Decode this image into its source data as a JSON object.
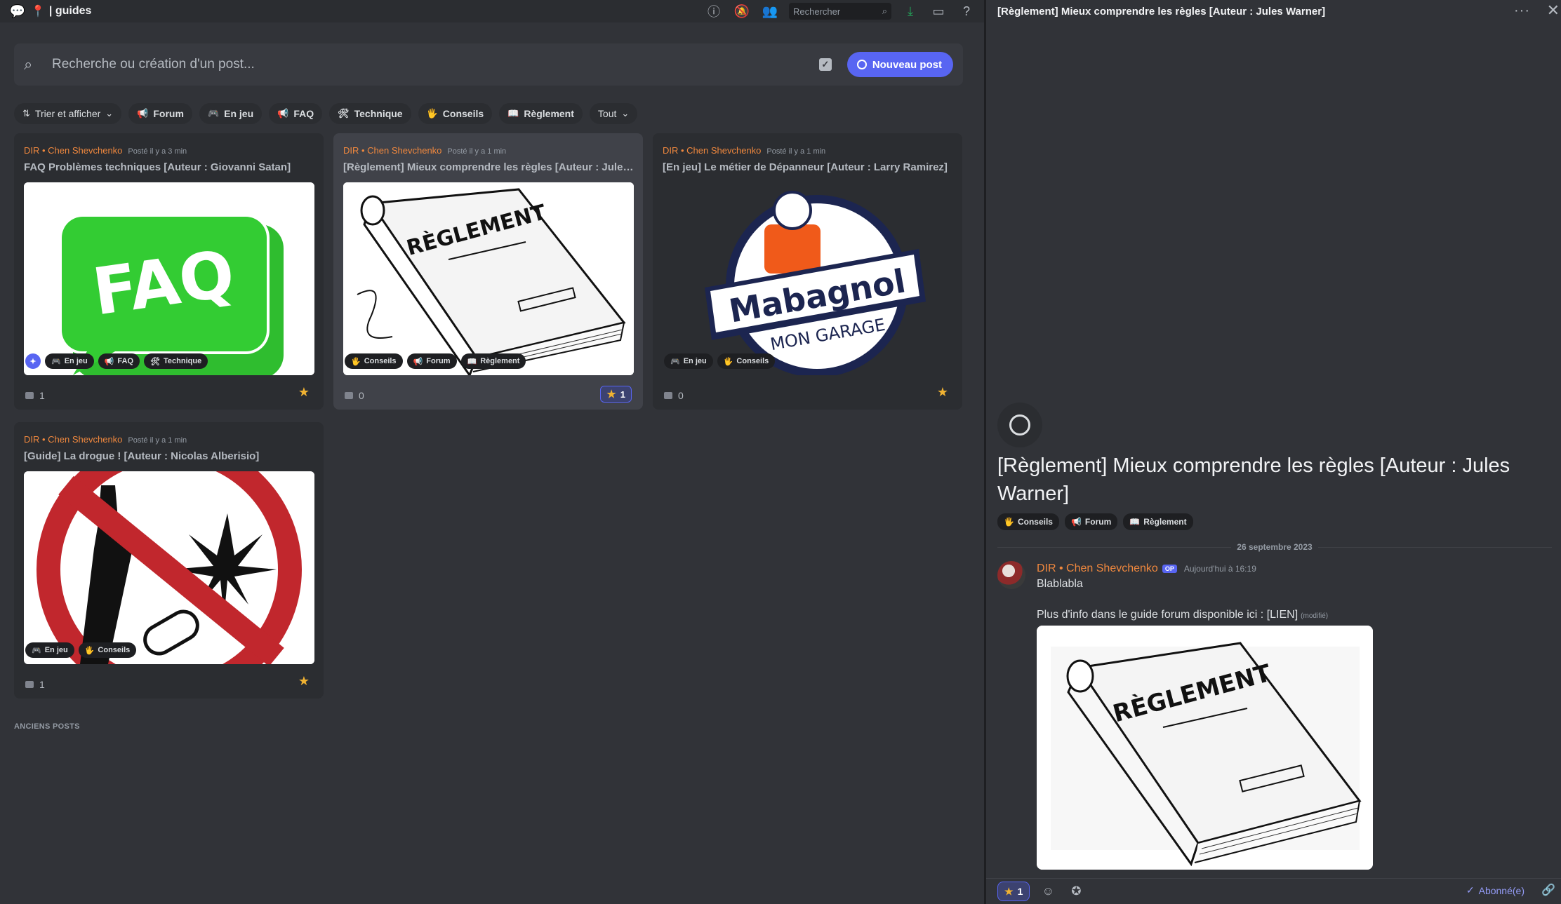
{
  "channel": {
    "emoji": "📍",
    "name": "| guides"
  },
  "topbar": {
    "search_placeholder": "Rechercher"
  },
  "searchbar": {
    "placeholder": "Recherche ou création d'un post...",
    "new_post_label": "Nouveau post"
  },
  "filters": {
    "sort_label": "Trier et afficher",
    "tags": [
      {
        "emoji": "📢",
        "label": "Forum"
      },
      {
        "emoji": "🎮",
        "label": "En jeu"
      },
      {
        "emoji": "📢",
        "label": "FAQ"
      },
      {
        "emoji": "🛠",
        "label": "Technique"
      },
      {
        "emoji": "🖐",
        "label": "Conseils"
      },
      {
        "emoji": "📖",
        "label": "Règlement"
      }
    ],
    "all_label": "Tout"
  },
  "posts": [
    {
      "author": "DIR • Chen Shevchenko",
      "time": "Posté il y a 3 min",
      "title": "FAQ Problèmes techniques [Auteur : Giovanni Satan]",
      "image": "FAQ",
      "tags": [
        "En jeu",
        "FAQ",
        "Technique"
      ],
      "comments": "1"
    },
    {
      "author": "DIR • Chen Shevchenko",
      "time": "Posté il y a 1 min",
      "title": "[Règlement] Mieux comprendre les règles [Auteur : Jules Warner]",
      "image": "RÈGLEMENT",
      "tags": [
        "Conseils",
        "Forum",
        "Règlement"
      ],
      "comments": "0",
      "stars": "1"
    },
    {
      "author": "DIR • Chen Shevchenko",
      "time": "Posté il y a 1 min",
      "title": "[En jeu] Le métier de Dépanneur [Auteur : Larry Ramirez]",
      "image_text_1": "Mabagnol",
      "image_text_2": "MON GARAGE",
      "tags": [
        "En jeu",
        "Conseils"
      ],
      "comments": "0"
    },
    {
      "author": "DIR • Chen Shevchenko",
      "time": "Posté il y a 1 min",
      "title": "[Guide] La drogue ! [Auteur : Nicolas Alberisio]",
      "tags": [
        "En jeu",
        "Conseils"
      ],
      "comments": "1"
    }
  ],
  "older_posts_label": "ANCIENS POSTS",
  "thread": {
    "header_title": "[Règlement] Mieux comprendre les règles [Auteur : Jules Warner]",
    "title": "[Règlement] Mieux comprendre les règles [Auteur : Jules Warner]",
    "tags": [
      {
        "emoji": "🖐",
        "label": "Conseils"
      },
      {
        "emoji": "📢",
        "label": "Forum"
      },
      {
        "emoji": "📖",
        "label": "Règlement"
      }
    ],
    "date": "26 septembre 2023",
    "author": "DIR • Chen Shevchenko",
    "op_badge": "OP",
    "time": "Aujourd'hui à 16:19",
    "line1": "Blablabla",
    "line2": "Plus d'info dans le guide forum disponible ici : [LIEN]",
    "edited": "(modifié)",
    "reaction_count": "1",
    "subscribed_label": "Abonné(e)"
  },
  "colors": {
    "accent": "#5865f2",
    "author": "#f0883e",
    "star": "#f0b232"
  }
}
